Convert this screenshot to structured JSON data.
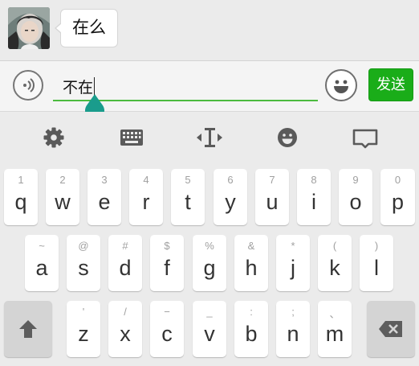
{
  "chat": {
    "message": "在么"
  },
  "input": {
    "value": "不在",
    "send_label": "发送"
  },
  "toolbar": {
    "icons": [
      "gear-icon",
      "keyboard-icon",
      "cursor-move-icon",
      "emoji-icon",
      "hide-keyboard-icon"
    ]
  },
  "keyboard": {
    "row1": [
      {
        "main": "q",
        "alt": "1"
      },
      {
        "main": "w",
        "alt": "2"
      },
      {
        "main": "e",
        "alt": "3"
      },
      {
        "main": "r",
        "alt": "4"
      },
      {
        "main": "t",
        "alt": "5"
      },
      {
        "main": "y",
        "alt": "6"
      },
      {
        "main": "u",
        "alt": "7"
      },
      {
        "main": "i",
        "alt": "8"
      },
      {
        "main": "o",
        "alt": "9"
      },
      {
        "main": "p",
        "alt": "0"
      }
    ],
    "row2": [
      {
        "main": "a",
        "alt": "~"
      },
      {
        "main": "s",
        "alt": "@"
      },
      {
        "main": "d",
        "alt": "#"
      },
      {
        "main": "f",
        "alt": "$"
      },
      {
        "main": "g",
        "alt": "%"
      },
      {
        "main": "h",
        "alt": "&"
      },
      {
        "main": "j",
        "alt": "*"
      },
      {
        "main": "k",
        "alt": "("
      },
      {
        "main": "l",
        "alt": ")"
      }
    ],
    "row3": [
      {
        "main": "z",
        "alt": "'"
      },
      {
        "main": "x",
        "alt": "/"
      },
      {
        "main": "c",
        "alt": "−"
      },
      {
        "main": "v",
        "alt": "_"
      },
      {
        "main": "b",
        "alt": ":"
      },
      {
        "main": "n",
        "alt": ";"
      },
      {
        "main": "m",
        "alt": "、"
      }
    ]
  },
  "colors": {
    "accent": "#1aad19",
    "handle": "#1a9c8c",
    "background": "#ebebeb"
  }
}
